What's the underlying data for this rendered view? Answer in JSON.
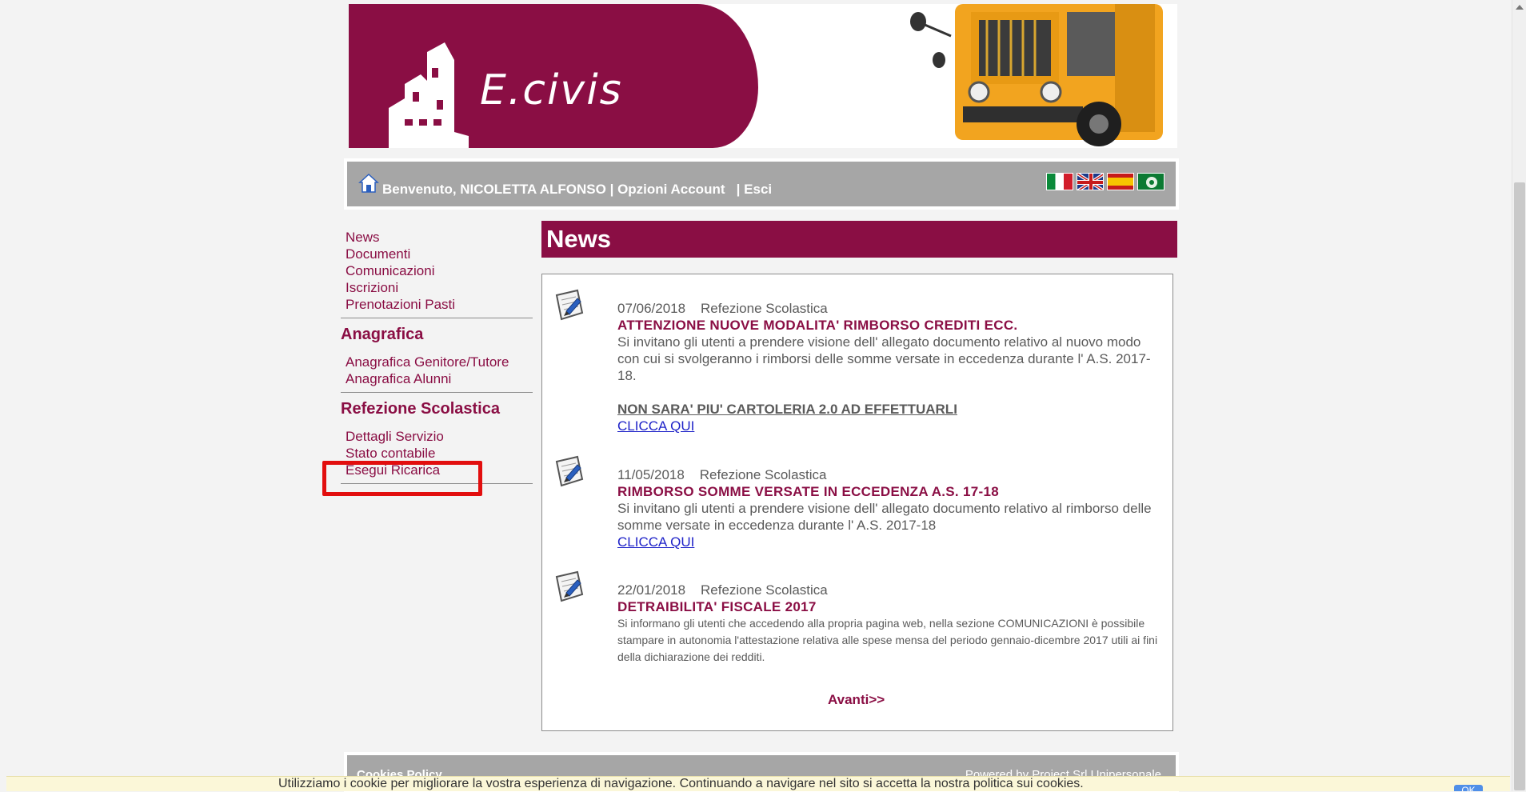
{
  "header": {
    "logo_text": "E.civis"
  },
  "userbar": {
    "welcome": "Benvenuto, NICOLETTA ALFONSO",
    "sep1": " | ",
    "account": "Opzioni Account",
    "sep2": "   | ",
    "logout": "Esci"
  },
  "nav": {
    "top_items": [
      "News",
      "Documenti",
      "Comunicazioni",
      "Iscrizioni",
      "Prenotazioni Pasti"
    ],
    "anagrafica_heading": "Anagrafica",
    "anagrafica_items": [
      "Anagrafica Genitore/Tutore",
      "Anagrafica Alunni"
    ],
    "refezione_heading": "Refezione Scolastica",
    "refezione_items": [
      "Dettagli Servizio",
      "Stato contabile",
      "Esegui Ricarica"
    ]
  },
  "main": {
    "section_title": "News",
    "news": [
      {
        "date": "07/06/2018",
        "category": "Refezione Scolastica",
        "title": "ATTENZIONE NUOVE MODALITA' RIMBORSO CREDITI ECC.",
        "text": "Si invitano gli utenti a prendere visione dell' allegato documento relativo al nuovo modo con cui si svolgeranno i  rimborsi delle somme versate in eccedenza durante l' A.S. 2017-18.",
        "extra_bold_link": "NON SARA' PIU' CARTOLERIA 2.0  AD EFFETTUARLI",
        "link": "CLICCA QUI"
      },
      {
        "date": "11/05/2018",
        "category": "Refezione Scolastica",
        "title": "RIMBORSO SOMME VERSATE IN ECCEDENZA A.S. 17-18",
        "text": "Si invitano gli utenti a prendere visione dell' allegato documento relativo al rimborso delle somme versate in eccedenza durante l' A.S. 2017-18",
        "link": "CLICCA QUI"
      },
      {
        "date": "22/01/2018",
        "category": "Refezione Scolastica",
        "title": "DETRAIBILITA' FISCALE 2017",
        "text": "Si informano gli utenti che accedendo alla propria pagina web, nella sezione COMUNICAZIONI è possibile stampare in autonomia l'attestazione relativa alle spese mensa del periodo gennaio-dicembre 2017 utili ai fini della dichiarazione dei redditi."
      }
    ],
    "next_label": "Avanti>>"
  },
  "footer": {
    "left": "Cookies Policy",
    "right": "Powered by Project Srl Unipersonale"
  },
  "cookie": {
    "text": "Utilizziamo i cookie per migliorare la vostra esperienza di navigazione. Continuando a navigare nel sito si accetta la nostra politica sui cookies.",
    "button": "OK"
  },
  "colors": {
    "brand": "#8a0e44",
    "bar": "#a6a6a6",
    "highlight": "#e20e0e",
    "link": "#1f23c8"
  }
}
